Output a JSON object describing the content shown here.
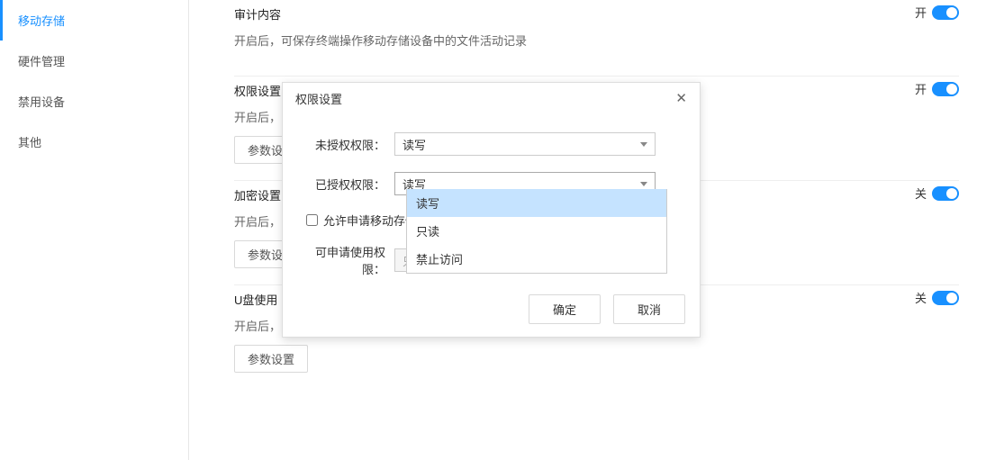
{
  "sidebar": {
    "items": [
      {
        "label": "移动存储",
        "active": true
      },
      {
        "label": "硬件管理"
      },
      {
        "label": "禁用设备"
      },
      {
        "label": "其他"
      }
    ]
  },
  "sections": {
    "audit": {
      "title": "审计内容",
      "desc": "开启后，可保存终端操作移动存储设备中的文件活动记录",
      "switch_label": "开",
      "switch_on": true
    },
    "perm": {
      "title": "权限设置",
      "desc": "开启后，",
      "btn": "参数设",
      "switch_label": "开",
      "switch_on": true
    },
    "enc": {
      "title": "加密设置",
      "desc": "开启后，",
      "btn": "参数设",
      "switch_label": "关",
      "switch_on": true
    },
    "usb": {
      "title": "U盘使用",
      "desc": "开启后，",
      "btn": "参数设置",
      "switch_label": "关",
      "switch_on": true
    }
  },
  "modal": {
    "title": "权限设置",
    "labels": {
      "unauth": "未授权权限：",
      "auth": "已授权权限：",
      "allow_apply": "允许申请移动存储",
      "applicable": "可申请使用权限："
    },
    "unauth_value": "读写",
    "auth_value": "读写",
    "applicable_value": "只读",
    "dropdown_options": [
      "读写",
      "只读",
      "禁止访问"
    ],
    "ok": "确定",
    "cancel": "取消"
  }
}
